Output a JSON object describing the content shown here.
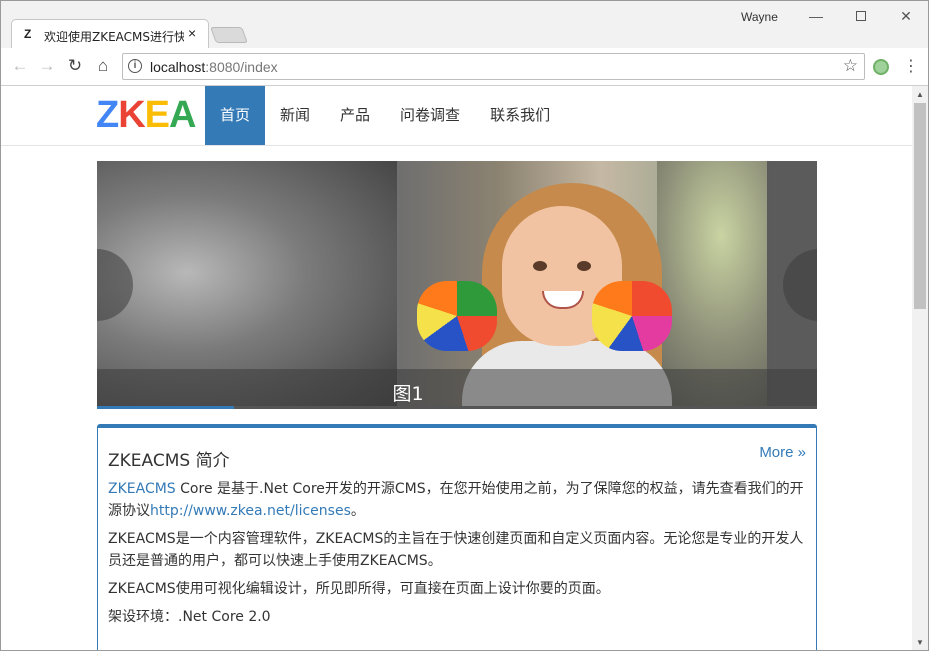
{
  "browser": {
    "tab_title": "欢迎使用ZKEACMS进行快速建站",
    "tab_favicon": "Z",
    "tab_close": "×",
    "profile_name": "Wayne",
    "url_host": "localhost",
    "url_rest": ":8080/index",
    "icons": {
      "back": "arrow-left-icon",
      "forward": "arrow-right-icon",
      "reload": "reload-icon",
      "home": "home-icon",
      "info": "info-icon",
      "bookmark": "star-icon",
      "extension": "extension-icon",
      "menu": "kebab-menu-icon"
    }
  },
  "site": {
    "logo": {
      "z": "Z",
      "k": "K",
      "e": "E",
      "a": "A"
    },
    "nav": [
      {
        "label": "首页",
        "active": true
      },
      {
        "label": "新闻"
      },
      {
        "label": "产品"
      },
      {
        "label": "问卷调查"
      },
      {
        "label": "联系我们"
      }
    ]
  },
  "carousel": {
    "caption": "图1",
    "progress_fraction": 0.19,
    "accent": "#337ab7"
  },
  "intro": {
    "title": "ZKEACMS 简介",
    "more": "More »",
    "p1_link": "ZKEACMS",
    "p1_text_a": " Core 是基于.Net Core开发的开源CMS，在您开始使用之前，为了保障您的权益，请先查看我们的开源协议",
    "p1_license_link": "http://www.zkea.net/licenses",
    "p1_text_b": "。",
    "p2": "ZKEACMS是一个内容管理软件，ZKEACMS的主旨在于快速创建页面和自定义页面内容。无论您是专业的开发人员还是普通的用户，都可以快速上手使用ZKEACMS。",
    "p3": "ZKEACMS使用可视化编辑设计，所见即所得，可直接在页面上设计你要的页面。",
    "p4": "架设环境：.Net Core 2.0"
  }
}
